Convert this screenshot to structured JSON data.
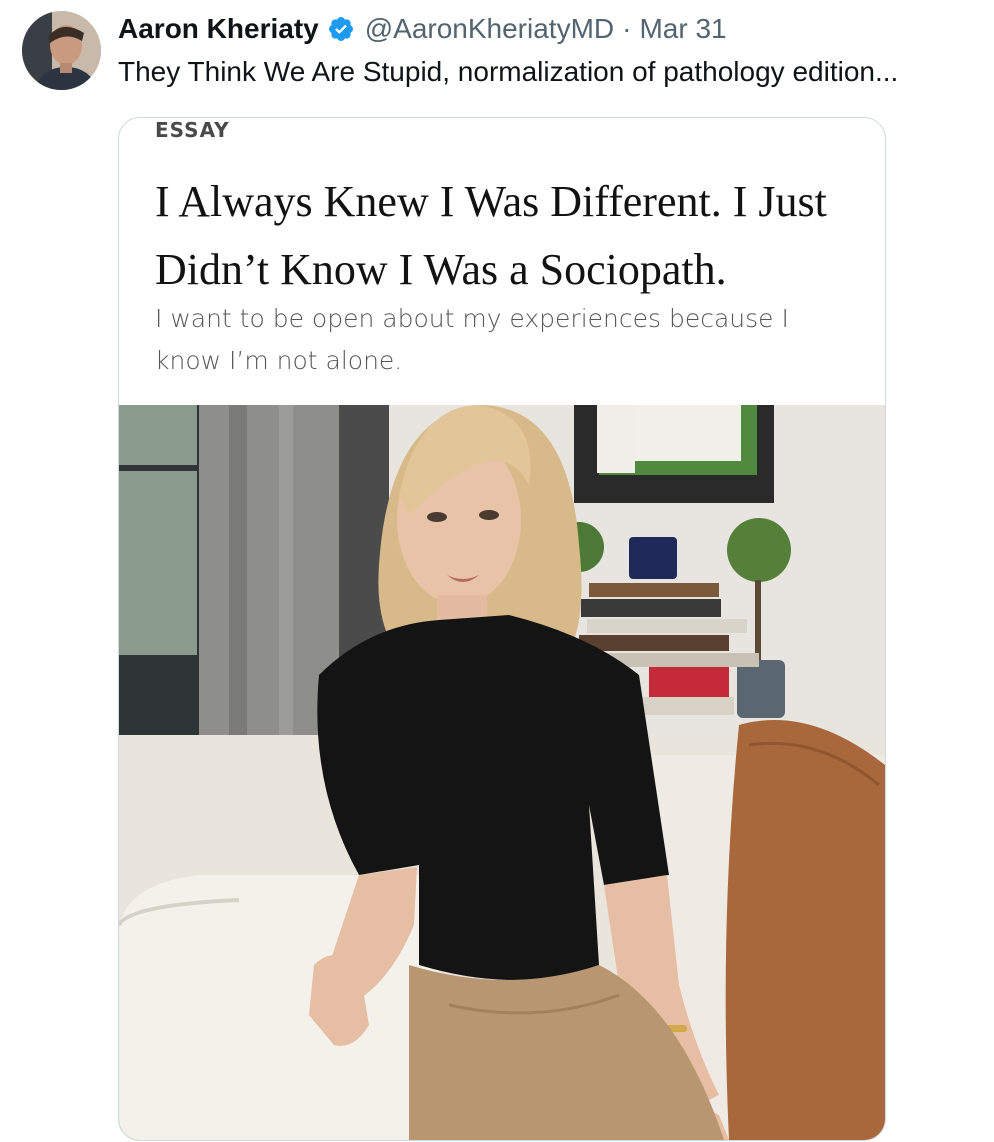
{
  "author": {
    "name": "Aaron Kheriaty",
    "handle": "@AaronKheriatyMD",
    "separator": "·",
    "date": "Mar 31",
    "verified_color": "#1d9bf0"
  },
  "tweet": {
    "text": "They Think We Are Stupid, normalization of pathology edition..."
  },
  "article": {
    "label": "ESSAY",
    "headline": "I Always Knew I Was Different. I Just Didn’t Know I Was a Sociopath.",
    "dek": "I want to be open about my experiences because I know I’m not alone."
  }
}
